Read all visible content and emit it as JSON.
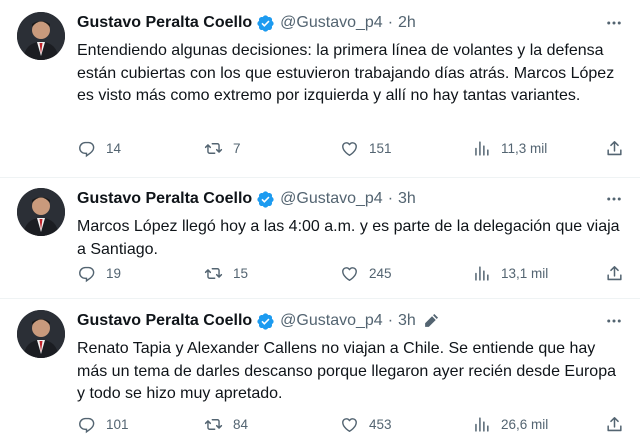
{
  "tweets": [
    {
      "name": "Gustavo Peralta Coello",
      "handle": "@Gustavo_p4",
      "separator": "·",
      "time": "2h",
      "edited": false,
      "text": "Entendiendo algunas decisiones: la primera línea de volantes y la defensa están cubiertas con los que estuvieron trabajando días atrás. Marcos López es visto más como extremo por izquierda y allí no hay tantas variantes.",
      "replies": "14",
      "retweets": "7",
      "likes": "151",
      "views": "11,3 mil"
    },
    {
      "name": "Gustavo Peralta Coello",
      "handle": "@Gustavo_p4",
      "separator": "·",
      "time": "3h",
      "edited": false,
      "text": "Marcos López llegó hoy a las 4:00 a.m. y es parte de la delegación que viaja a Santiago.",
      "replies": "19",
      "retweets": "15",
      "likes": "245",
      "views": "13,1 mil"
    },
    {
      "name": "Gustavo Peralta Coello",
      "handle": "@Gustavo_p4",
      "separator": "·",
      "time": "3h",
      "edited": true,
      "text": "Renato Tapia y Alexander Callens no viajan a Chile. Se entiende que hay más un tema de darles descanso porque llegaron ayer recién desde Europa y todo se hizo muy apretado.",
      "replies": "101",
      "retweets": "84",
      "likes": "453",
      "views": "26,6 mil"
    }
  ],
  "icons": {
    "verified": "verified-badge-icon",
    "more": "more-horizontal-icon",
    "reply": "reply-icon",
    "retweet": "retweet-icon",
    "like": "heart-icon",
    "views": "views-icon",
    "share": "share-icon",
    "edit": "edit-pencil-icon"
  },
  "colors": {
    "verified": "#1d9bf0",
    "muted": "#536471",
    "text": "#0f1419",
    "divider": "#eff3f4"
  }
}
